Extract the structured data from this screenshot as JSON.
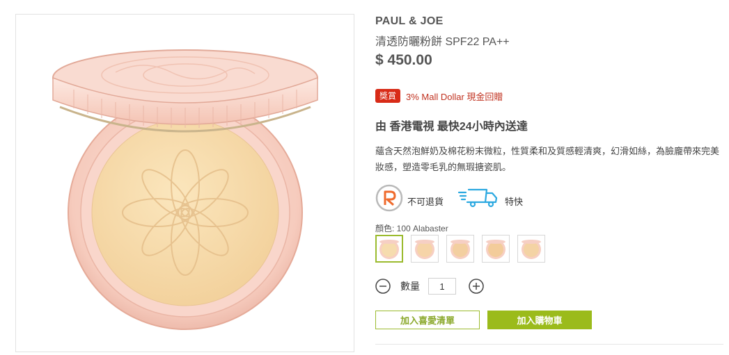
{
  "product": {
    "brand": "PAUL & JOE",
    "name": "清透防曬粉餅 SPF22 PA++",
    "price": "$ 450.00",
    "reward_badge": "獎賞",
    "reward_text": "3% Mall Dollar 現金回贈",
    "delivery": "由 香港電視 最快24小時內送達",
    "description": "蘊含天然泡鮮奶及棉花粉末微粒，性質柔和及質感輕清爽，幻滑如絲，為臉龐帶來完美妝感，塑造零毛乳的無瑕搪瓷肌。",
    "policies": [
      {
        "label": "不可退貨",
        "icon": "no-return-icon"
      },
      {
        "label": "特快",
        "icon": "express-truck-icon"
      }
    ],
    "color_label": "顏色: 100 Alabaster",
    "swatches": [
      {
        "selected": true,
        "tone": "#f6dcae"
      },
      {
        "selected": false,
        "tone": "#f6d4a8"
      },
      {
        "selected": false,
        "tone": "#f3cfa0"
      },
      {
        "selected": false,
        "tone": "#f3cc9a"
      },
      {
        "selected": false,
        "tone": "#f4d3a4"
      }
    ],
    "quantity_label": "數量",
    "quantity": "1",
    "wishlist_label": "加入喜愛清單",
    "cart_label": "加入購物車"
  },
  "colors": {
    "accent_green": "#9bbb1b",
    "reward_red": "#d82b17",
    "compact_pink": "#f6cfc4",
    "powder": "#f7dca9"
  }
}
